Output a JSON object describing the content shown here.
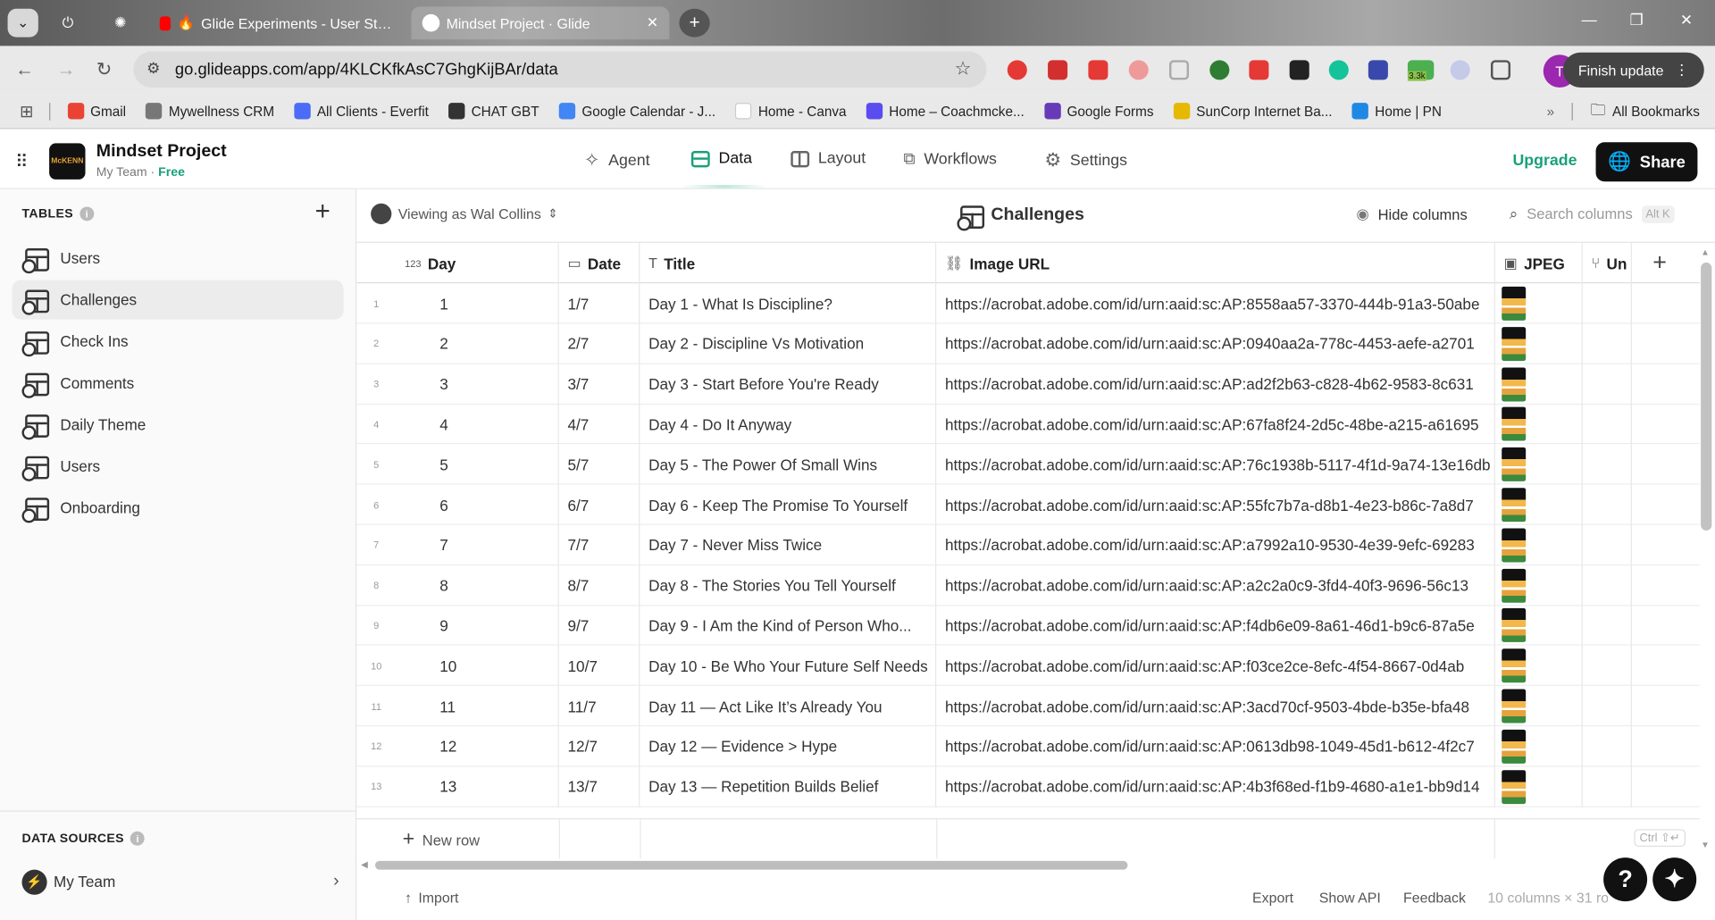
{
  "browser": {
    "tabs": [
      {
        "title": "Glide Experiments - User St…",
        "active": false
      },
      {
        "title": "Mindset Project · Glide",
        "active": true
      }
    ],
    "url": "go.glideapps.com/app/4KLCKfkAsC7GhgKijBAr/data",
    "profile_initial": "T",
    "finish_update": "Finish update",
    "extension_badge": "3.3k",
    "bookmarks": [
      {
        "label": "Gmail",
        "color": "#ea4335"
      },
      {
        "label": "Mywellness CRM",
        "color": "#777777"
      },
      {
        "label": "All Clients - Everfit",
        "color": "#4a6cf7"
      },
      {
        "label": "CHAT GBT",
        "color": "#333333"
      },
      {
        "label": "Google Calendar - J...",
        "color": "#4285f4"
      },
      {
        "label": "Home - Canva",
        "color": "#ffffff"
      },
      {
        "label": "Home – Coachmcke...",
        "color": "#5b4cf0"
      },
      {
        "label": "Google Forms",
        "color": "#673ab7"
      },
      {
        "label": "SunCorp Internet Ba...",
        "color": "#e6b800"
      },
      {
        "label": "Home | PN",
        "color": "#1e88e5"
      }
    ],
    "all_bookmarks": "All Bookmarks"
  },
  "app": {
    "name": "Mindset Project",
    "team": "My Team",
    "plan": "Free",
    "nav": [
      "Agent",
      "Data",
      "Layout",
      "Workflows",
      "Settings"
    ],
    "active_nav": "Data",
    "upgrade": "Upgrade",
    "share": "Share"
  },
  "sidebar": {
    "tables_label": "TABLES",
    "tables": [
      "Users",
      "Challenges",
      "Check Ins",
      "Comments",
      "Daily Theme",
      "Users",
      "Onboarding"
    ],
    "selected": "Challenges",
    "data_sources_label": "DATA SOURCES",
    "source": "My Team"
  },
  "toolbar": {
    "viewing_as": "Viewing as Wal Collins",
    "table_title": "Challenges",
    "hide_columns": "Hide columns",
    "search_placeholder": "Search columns",
    "search_shortcut": "Alt K"
  },
  "columns": [
    {
      "label": "Day",
      "type_glyph": "123"
    },
    {
      "label": "Date",
      "type_glyph": "▭"
    },
    {
      "label": "Title",
      "type_glyph": "T"
    },
    {
      "label": "Image URL",
      "type_glyph": "⛓"
    },
    {
      "label": "JPEG",
      "type_glyph": "▣"
    },
    {
      "label": "Un",
      "type_glyph": "⑂"
    }
  ],
  "rows": [
    {
      "n": "1",
      "day": "1",
      "date": "1/7",
      "title": "Day 1 - What Is Discipline?",
      "url": "https://acrobat.adobe.com/id/urn:aaid:sc:AP:8558aa57-3370-444b-91a3-50abe"
    },
    {
      "n": "2",
      "day": "2",
      "date": "2/7",
      "title": "Day 2 - Discipline Vs Motivation",
      "url": "https://acrobat.adobe.com/id/urn:aaid:sc:AP:0940aa2a-778c-4453-aefe-a2701"
    },
    {
      "n": "3",
      "day": "3",
      "date": "3/7",
      "title": "Day 3 - Start Before You're Ready",
      "url": "https://acrobat.adobe.com/id/urn:aaid:sc:AP:ad2f2b63-c828-4b62-9583-8c631"
    },
    {
      "n": "4",
      "day": "4",
      "date": "4/7",
      "title": "Day 4 - Do It Anyway",
      "url": "https://acrobat.adobe.com/id/urn:aaid:sc:AP:67fa8f24-2d5c-48be-a215-a61695"
    },
    {
      "n": "5",
      "day": "5",
      "date": "5/7",
      "title": "Day 5 - The Power Of Small Wins",
      "url": "https://acrobat.adobe.com/id/urn:aaid:sc:AP:76c1938b-5117-4f1d-9a74-13e16db"
    },
    {
      "n": "6",
      "day": "6",
      "date": "6/7",
      "title": "Day 6 - Keep The Promise To Yourself",
      "url": "https://acrobat.adobe.com/id/urn:aaid:sc:AP:55fc7b7a-d8b1-4e23-b86c-7a8d7"
    },
    {
      "n": "7",
      "day": "7",
      "date": "7/7",
      "title": "Day 7 - Never Miss Twice",
      "url": "https://acrobat.adobe.com/id/urn:aaid:sc:AP:a7992a10-9530-4e39-9efc-69283"
    },
    {
      "n": "8",
      "day": "8",
      "date": "8/7",
      "title": "Day 8 - The Stories You Tell Yourself",
      "url": "https://acrobat.adobe.com/id/urn:aaid:sc:AP:a2c2a0c9-3fd4-40f3-9696-56c13"
    },
    {
      "n": "9",
      "day": "9",
      "date": "9/7",
      "title": "Day 9 - I Am the Kind of Person Who...",
      "url": "https://acrobat.adobe.com/id/urn:aaid:sc:AP:f4db6e09-8a61-46d1-b9c6-87a5e"
    },
    {
      "n": "10",
      "day": "10",
      "date": "10/7",
      "title": "Day 10 - Be Who Your Future Self Needs",
      "url": "https://acrobat.adobe.com/id/urn:aaid:sc:AP:f03ce2ce-8efc-4f54-8667-0d4ab"
    },
    {
      "n": "11",
      "day": "11",
      "date": "11/7",
      "title": "Day 11 — Act Like It’s Already You",
      "url": "https://acrobat.adobe.com/id/urn:aaid:sc:AP:3acd70cf-9503-4bde-b35e-bfa48"
    },
    {
      "n": "12",
      "day": "12",
      "date": "12/7",
      "title": "Day 12 — Evidence > Hype",
      "url": "https://acrobat.adobe.com/id/urn:aaid:sc:AP:0613db98-1049-45d1-b612-4f2c7"
    },
    {
      "n": "13",
      "day": "13",
      "date": "13/7",
      "title": "Day 13 — Repetition Builds Belief",
      "url": "https://acrobat.adobe.com/id/urn:aaid:sc:AP:4b3f68ed-f1b9-4680-a1e1-bb9d14"
    }
  ],
  "footer": {
    "new_row": "New row",
    "kbd_hint": "Ctrl ⇧↵",
    "import": "Import",
    "export": "Export",
    "show_api": "Show API",
    "feedback": "Feedback",
    "summary": "10 columns × 31 ro"
  }
}
